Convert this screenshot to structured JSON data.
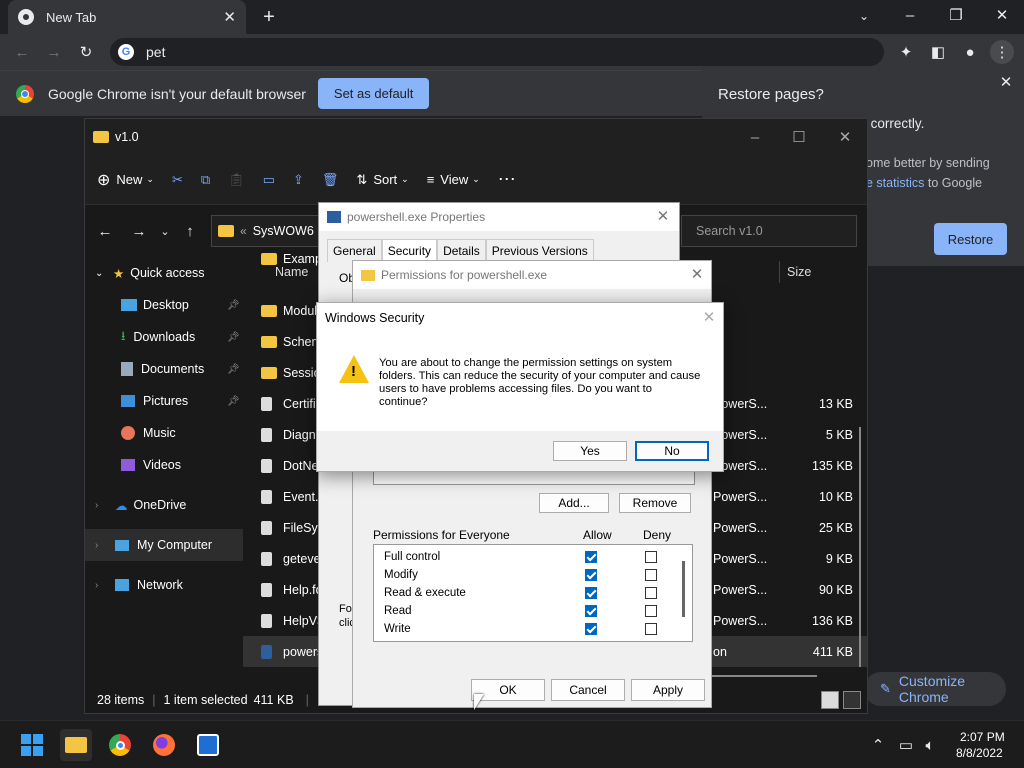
{
  "chrome": {
    "tab_title": "New Tab",
    "omnibox_value": "pet",
    "infobar_message": "Google Chrome isn't your default browser",
    "set_default_label": "Set as default",
    "restore_title": "Restore pages?",
    "restore_line1": "Chrome didn't shut down correctly.",
    "restore_line2a": "ome better by sending",
    "restore_link": "e statistics",
    "restore_line3": "to Google",
    "restore_button": "Restore",
    "customize_label": "Customize Chrome"
  },
  "explorer": {
    "title": "v1.0",
    "cmd": {
      "new": "New",
      "sort": "Sort",
      "view": "View"
    },
    "address": "SysWOW6",
    "search_placeholder": "Search v1.0",
    "col_name": "Name",
    "col_size": "Size",
    "nav": {
      "quick_access": "Quick access",
      "desktop": "Desktop",
      "downloads": "Downloads",
      "documents": "Documents",
      "pictures": "Pictures",
      "music": "Music",
      "videos": "Videos",
      "onedrive": "OneDrive",
      "my_computer": "My Computer",
      "network": "Network"
    },
    "files": [
      {
        "name": "Examp",
        "type": "",
        "size": ""
      },
      {
        "name": "Modul",
        "type": "",
        "size": ""
      },
      {
        "name": "Schem",
        "type": "",
        "size": ""
      },
      {
        "name": "Sessio",
        "type": "",
        "size": ""
      },
      {
        "name": "Certifi",
        "type": "PowerS...",
        "size": "13 KB"
      },
      {
        "name": "Diagn",
        "type": "PowerS...",
        "size": "5 KB"
      },
      {
        "name": "DotNe",
        "type": "PowerS...",
        "size": "135 KB"
      },
      {
        "name": "Event.F",
        "type": "PowerS...",
        "size": "10 KB"
      },
      {
        "name": "FileSys",
        "type": "PowerS...",
        "size": "25 KB"
      },
      {
        "name": "geteve",
        "type": "PowerS...",
        "size": "9 KB"
      },
      {
        "name": "Help.fo",
        "type": "PowerS...",
        "size": "90 KB"
      },
      {
        "name": "HelpV3",
        "type": "PowerS...",
        "size": "136 KB"
      },
      {
        "name": "powers",
        "type": "on",
        "size": "411 KB"
      }
    ],
    "status_items": "28 items",
    "status_selected": "1 item selected",
    "status_size": "411 KB"
  },
  "props": {
    "title": "powershell.exe Properties",
    "tabs": [
      "General",
      "Security",
      "Details",
      "Previous Versions"
    ],
    "obj_label": "Ob",
    "for_text": "For",
    "cli_text": "clic"
  },
  "perm": {
    "title": "Permissions for powershell.exe",
    "add_label": "Add...",
    "remove_label": "Remove",
    "permissions_for": "Permissions for Everyone",
    "allow": "Allow",
    "deny": "Deny",
    "rows": [
      {
        "name": "Full control",
        "allow": true,
        "deny": false
      },
      {
        "name": "Modify",
        "allow": true,
        "deny": false
      },
      {
        "name": "Read & execute",
        "allow": true,
        "deny": false
      },
      {
        "name": "Read",
        "allow": true,
        "deny": false
      },
      {
        "name": "Write",
        "allow": true,
        "deny": false
      }
    ],
    "ok": "OK",
    "cancel": "Cancel",
    "apply": "Apply"
  },
  "winsec": {
    "title": "Windows Security",
    "message": "You are about to change the permission settings on system folders. This can reduce the security of your computer and cause users to have problems accessing files. Do you want to continue?",
    "yes": "Yes",
    "no": "No"
  },
  "taskbar": {
    "time": "2:07 PM",
    "date": "8/8/2022"
  }
}
